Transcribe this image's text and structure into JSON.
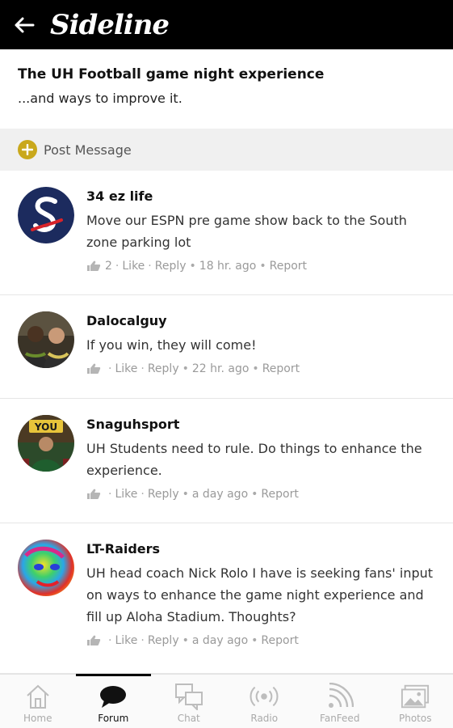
{
  "header": {
    "brand": "Sideline"
  },
  "topic": {
    "title": "The UH Football game night experience",
    "subtitle": "...and ways to improve it."
  },
  "post_bar": {
    "label": "Post Message"
  },
  "comments": [
    {
      "author": "34 ez life",
      "text": "Move our ESPN pre game show back to the South zone parking lot",
      "likes": "2",
      "like_label": "Like",
      "reply_label": "Reply",
      "time": "18 hr. ago",
      "report_label": "Report"
    },
    {
      "author": "Dalocalguy",
      "text": "If you win, they will come!",
      "likes": "",
      "like_label": "Like",
      "reply_label": "Reply",
      "time": "22 hr. ago",
      "report_label": "Report"
    },
    {
      "author": "Snaguhsport",
      "text": "UH Students need to rule. Do things to enhance the experience.",
      "likes": "",
      "like_label": "Like",
      "reply_label": "Reply",
      "time": "a day ago",
      "report_label": "Report"
    },
    {
      "author": "LT-Raiders",
      "text": "UH head coach Nick Rolo I have is seeking fans' input on ways to enhance the game night experience and fill up Aloha Stadium. Thoughts?",
      "likes": "",
      "like_label": "Like",
      "reply_label": "Reply",
      "time": "a day ago",
      "report_label": "Report"
    }
  ],
  "avatar_text": {
    "snaguhsport_sign": "YOU"
  },
  "nav": {
    "items": [
      {
        "label": "Home",
        "icon": "home-icon"
      },
      {
        "label": "Forum",
        "icon": "forum-icon"
      },
      {
        "label": "Chat",
        "icon": "chat-icon"
      },
      {
        "label": "Radio",
        "icon": "radio-icon"
      },
      {
        "label": "FanFeed",
        "icon": "fanfeed-icon"
      },
      {
        "label": "Photos",
        "icon": "photos-icon"
      }
    ],
    "active": "Forum"
  },
  "colors": {
    "header_bg": "#000000",
    "accent": "#c9a81c",
    "post_bar_bg": "#f0f0f0",
    "meta_text": "#9a9a9a"
  }
}
